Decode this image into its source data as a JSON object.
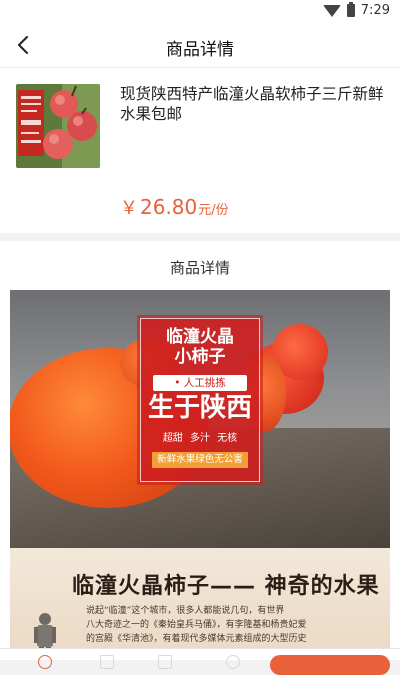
{
  "status_bar": {
    "time": "7:29"
  },
  "header": {
    "title": "商品详情"
  },
  "product": {
    "name": "现货陕西特产临潼火晶软柿子三斤新鲜水果包邮",
    "price_symbol": "￥",
    "price": "26.80",
    "price_unit": "元/份"
  },
  "details": {
    "section_title": "商品详情",
    "poster": {
      "line1": "临潼火晶",
      "line2": "小柿子",
      "pill": "• 人工挑拣",
      "big": "生于陕西",
      "tags": "超甜 多汁 无核",
      "footer": "新鲜水果绿色无公害"
    },
    "headline": "临潼火晶柿子—— 神奇的水果",
    "desc_line1": "说起“临潼”这个城市，很多人都能说几句，有世界",
    "desc_line2": "八大奇迹之一的《秦始皇兵马俑》，有李隆基和杨贵妃爱",
    "desc_line3": "的宫殿《华清池》，有着现代多媒体元素组成的大型历史"
  },
  "colors": {
    "accent": "#e8613a",
    "poster_red": "#ce2020"
  }
}
